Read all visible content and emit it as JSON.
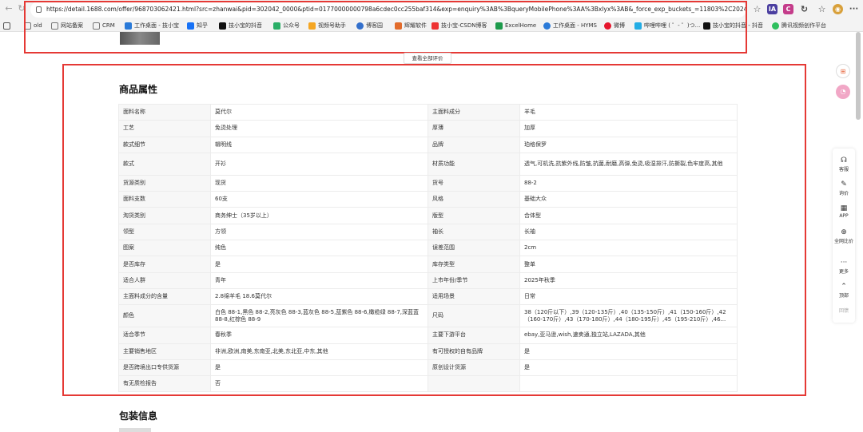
{
  "browser": {
    "url": "https://detail.1688.com/offer/968703062421.html?src=zhanwai&pid=302042_0000&ptid=01770000000798a6cdec0cc255baf314&exp=enquiry%3AB%3BqueryMobilePhone%3AA%3Bxlyx%3AB&_force_exp_buckets_=11803%2C2024061701%2C20...",
    "toolbar_icons": [
      "A",
      "IA",
      "C"
    ],
    "bookmarks": [
      "old",
      "网站备案",
      "CRM",
      "工作桌面 - 技小宝",
      "知乎",
      "技小宝的抖音",
      "公众号",
      "视频号助手",
      "博客园",
      "辉耀软件",
      "技小宝-CSDN博客",
      "ExcelHome",
      "工作桌面 - HYMS",
      "微博",
      "哔哩哔哩 ( ゜- ゜)つ...",
      "技小宝的抖音 - 抖音",
      "腾讯视频创作平台"
    ]
  },
  "reviews": {
    "button_label": "查看全部评价"
  },
  "attributes": {
    "title": "商品属性",
    "rows": [
      [
        "面料名称",
        "莫代尔",
        "主面料成分",
        "羊毛"
      ],
      [
        "工艺",
        "免烫处理",
        "厚薄",
        "加厚"
      ],
      [
        "款式细节",
        "辑明线",
        "品牌",
        "珀格保罗"
      ],
      [
        "款式",
        "开衫",
        "材质功能",
        "透气,可机洗,抗紫外线,防皱,抗菌,耐磨,高弹,免烫,吸湿排汗,防撕裂,色牢度高,其他"
      ],
      [
        "货源类别",
        "现货",
        "货号",
        "88-2"
      ],
      [
        "面料支数",
        "60支",
        "风格",
        "基础大众"
      ],
      [
        "淘货类别",
        "商务绅士（35岁以上）",
        "版型",
        "合体型"
      ],
      [
        "领型",
        "方领",
        "袖长",
        "长袖"
      ],
      [
        "图案",
        "纯色",
        "误差范围",
        "2cm"
      ],
      [
        "是否库存",
        "是",
        "库存类型",
        "整单"
      ],
      [
        "适合人群",
        "青年",
        "上市年份/季节",
        "2025年秋季"
      ],
      [
        "主面料成分的含量",
        "2.8绵羊毛 18.6莫代尔",
        "适用场景",
        "日常"
      ],
      [
        "颜色",
        "白色 88-1,黑色 88-2,亮灰色 88-3,蓝灰色 88-5,蓝紫色 88-6,橄榄绿 88-7,深蓝蓝 88-8,红棕色 88-9",
        "尺码",
        "38（120斤以下）,39（120-135斤）,40（135-150斤）,41（150-160斤）,42（160-170斤）,43（170-180斤）,44（180-195斤）,45（195-210斤）,46..."
      ],
      [
        "适合季节",
        "春秋季",
        "主要下游平台",
        "ebay,亚马逊,wish,速卖通,独立站,LAZADA,其他"
      ],
      [
        "主要销售地区",
        "非洲,欧洲,南美,东南亚,北美,东北亚,中东,其他",
        "有可授权的自有品牌",
        "是"
      ],
      [
        "是否跨境出口专供货源",
        "是",
        "原创设计货源",
        "是"
      ],
      [
        "有无质检报告",
        "否",
        "",
        ""
      ]
    ]
  },
  "packaging": {
    "title": "包装信息"
  },
  "side_panel": {
    "items": [
      {
        "icon": "headset-icon",
        "glyph": "☊",
        "label": "客服"
      },
      {
        "icon": "inquiry-icon",
        "glyph": "✎",
        "label": "询价"
      },
      {
        "icon": "grid-icon",
        "glyph": "▦",
        "label": "APP"
      },
      {
        "icon": "compare-icon",
        "glyph": "⊕",
        "label": "全网比价"
      },
      {
        "icon": "more-icon",
        "glyph": "···",
        "label": "更多"
      },
      {
        "icon": "top-arrow-icon",
        "glyph": "⌃",
        "label": "顶部"
      },
      {
        "icon": "feedback-icon",
        "glyph": "",
        "label": "回馈"
      }
    ]
  },
  "colors": {
    "highlight": "#e53935",
    "key_cell_bg": "#f7f7f7",
    "border": "#ececec"
  }
}
